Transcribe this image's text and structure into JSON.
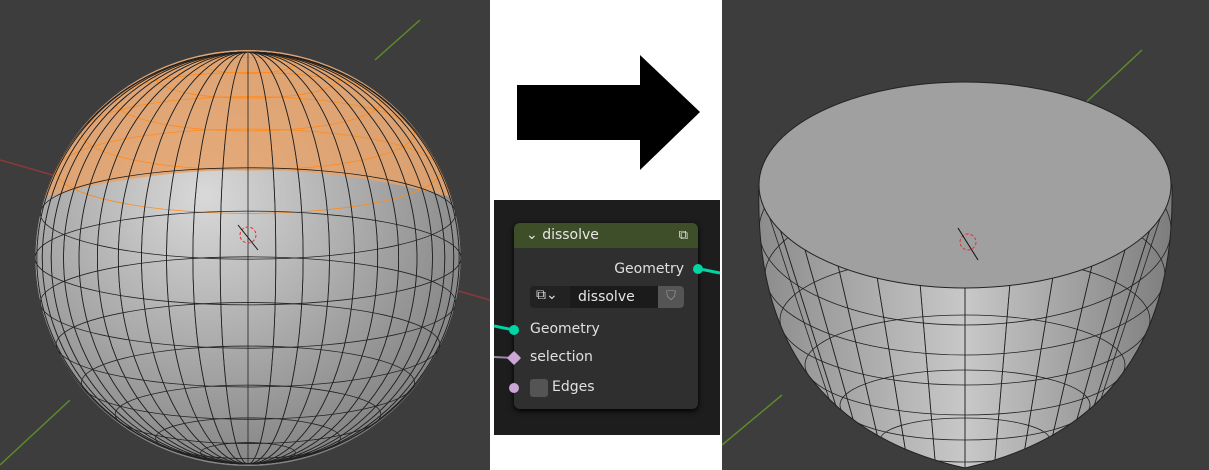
{
  "node": {
    "title": "dissolve",
    "output_socket": "Geometry",
    "group_name": "dissolve",
    "inputs": [
      "Geometry",
      "selection"
    ],
    "edges_label": "Edges",
    "edges_checked": false
  },
  "colors": {
    "socket_geometry": "#00d6a3",
    "socket_field": "#cca6d6",
    "header": "#3e4e28",
    "selection": "#ff8a1a"
  }
}
